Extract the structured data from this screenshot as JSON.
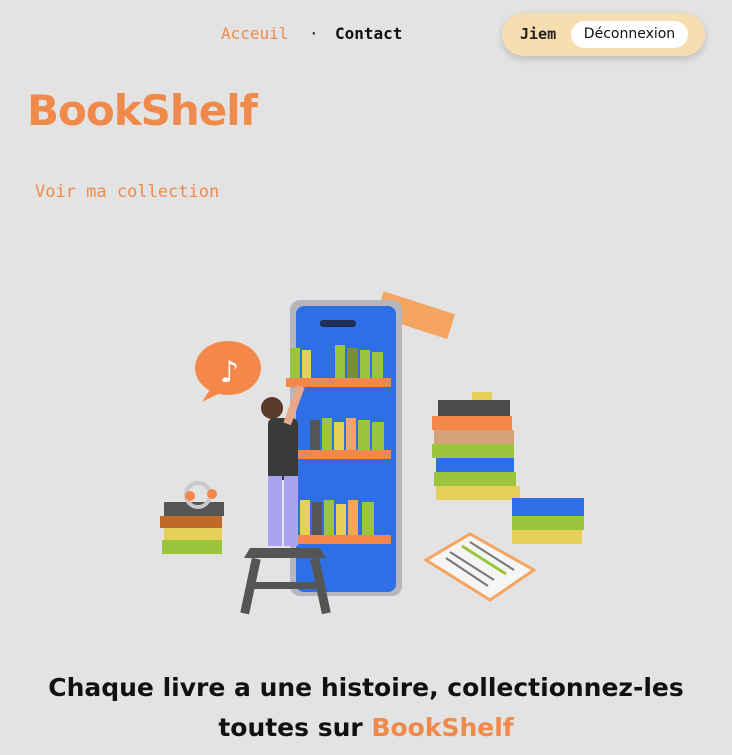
{
  "nav": {
    "home_label": "Acceuil",
    "separator": "·",
    "contact_label": "Contact"
  },
  "user": {
    "name": "Jiem",
    "logout_label": "Déconnexion"
  },
  "brand": {
    "title": "BookShelf"
  },
  "main": {
    "collection_link": "Voir ma collection",
    "tagline_part1": "Chaque livre a une histoire, collectionnez-les",
    "tagline_part2": "toutes sur ",
    "tagline_highlight": "BookShelf"
  },
  "colors": {
    "accent": "#f08a4b",
    "background": "#e4e3e3",
    "user_pill": "#f7deb0"
  },
  "illustration": {
    "icon": "person-shelving-books-on-phone-illustration"
  }
}
